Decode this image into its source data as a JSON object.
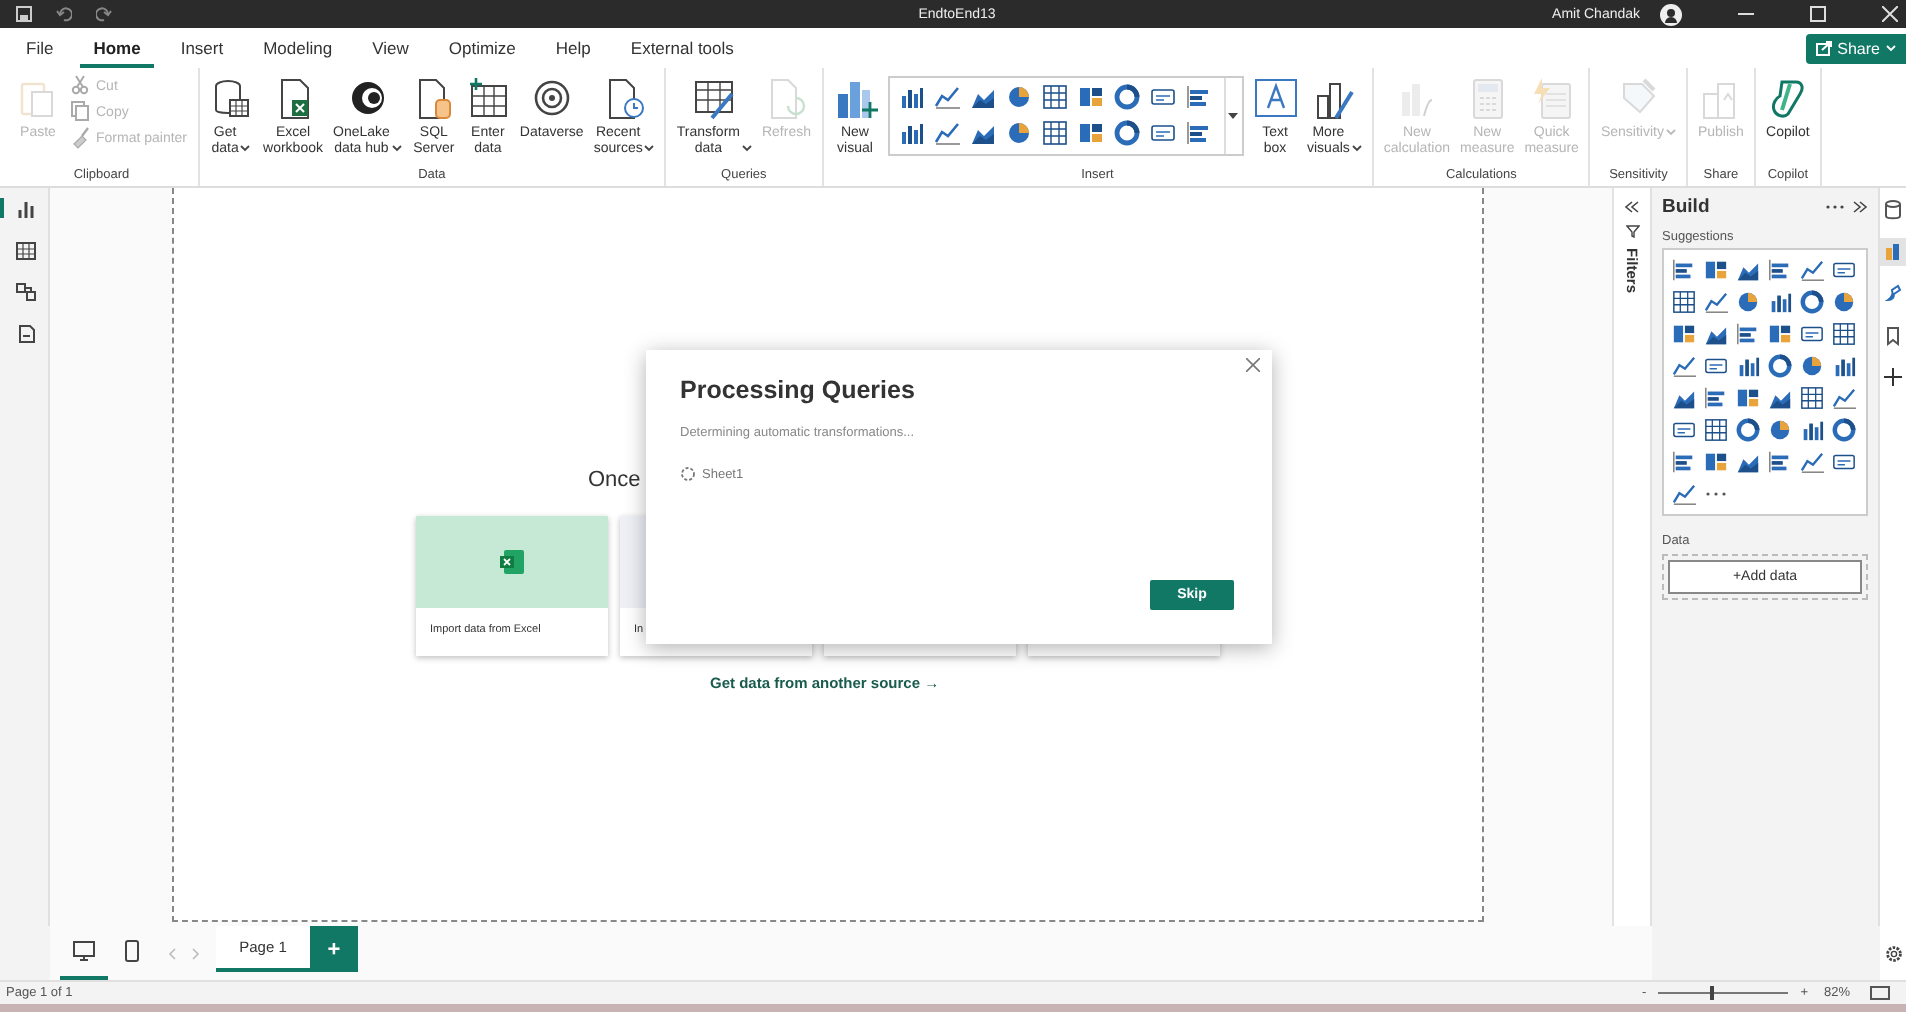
{
  "title_bar": {
    "title": "EndtoEnd13",
    "user": "Amit Chandak"
  },
  "menu_tabs": [
    {
      "label": "File",
      "selected": false
    },
    {
      "label": "Home",
      "selected": true
    },
    {
      "label": "Insert",
      "selected": false
    },
    {
      "label": "Modeling",
      "selected": false
    },
    {
      "label": "View",
      "selected": false
    },
    {
      "label": "Optimize",
      "selected": false
    },
    {
      "label": "Help",
      "selected": false
    },
    {
      "label": "External tools",
      "selected": false
    }
  ],
  "share_button": {
    "label": "Share"
  },
  "ribbon_groups": [
    {
      "label": "Clipboard",
      "buttons": [
        {
          "kind": "large",
          "label": "Paste",
          "disabled": true,
          "dropdown": false
        },
        {
          "kind": "small",
          "label": "Cut",
          "disabled": true,
          "dropdown": false
        },
        {
          "kind": "small",
          "label": "Copy",
          "disabled": true,
          "dropdown": false
        },
        {
          "kind": "small",
          "label": "Format painter",
          "disabled": true,
          "dropdown": false
        }
      ]
    },
    {
      "label": "Data",
      "buttons": [
        {
          "kind": "large",
          "label": "Get\ndata",
          "disabled": false,
          "dropdown": true
        },
        {
          "kind": "large",
          "label": "Excel\nworkbook",
          "disabled": false,
          "dropdown": false
        },
        {
          "kind": "large",
          "label": "OneLake\ndata hub",
          "disabled": false,
          "dropdown": true
        },
        {
          "kind": "large",
          "label": "SQL\nServer",
          "disabled": false,
          "dropdown": false
        },
        {
          "kind": "large",
          "label": "Enter\ndata",
          "disabled": false,
          "dropdown": false
        },
        {
          "kind": "large",
          "label": "Dataverse",
          "disabled": false,
          "dropdown": false
        },
        {
          "kind": "large",
          "label": "Recent\nsources",
          "disabled": false,
          "dropdown": true
        }
      ]
    },
    {
      "label": "Queries",
      "buttons": [
        {
          "kind": "large",
          "label": "Transform\ndata",
          "disabled": false,
          "dropdown": true
        },
        {
          "kind": "large",
          "label": "Refresh",
          "disabled": true,
          "dropdown": false
        }
      ]
    },
    {
      "label": "Insert",
      "buttons": [
        {
          "kind": "large",
          "label": "New\nvisual",
          "disabled": false,
          "dropdown": false
        },
        {
          "kind": "gallery"
        },
        {
          "kind": "large",
          "label": "Text\nbox",
          "disabled": false,
          "dropdown": false
        },
        {
          "kind": "large",
          "label": "More\nvisuals",
          "disabled": false,
          "dropdown": true
        }
      ]
    },
    {
      "label": "Calculations",
      "buttons": [
        {
          "kind": "large",
          "label": "New\ncalculation",
          "disabled": true,
          "dropdown": false
        },
        {
          "kind": "large",
          "label": "New\nmeasure",
          "disabled": true,
          "dropdown": false
        },
        {
          "kind": "large",
          "label": "Quick\nmeasure",
          "disabled": true,
          "dropdown": false
        }
      ]
    },
    {
      "label": "Sensitivity",
      "buttons": [
        {
          "kind": "large",
          "label": "Sensitivity",
          "disabled": true,
          "dropdown": true
        }
      ]
    },
    {
      "label": "Share",
      "buttons": [
        {
          "kind": "large",
          "label": "Publish",
          "disabled": true,
          "dropdown": false
        }
      ]
    },
    {
      "label": "Copilot",
      "buttons": [
        {
          "kind": "large",
          "label": "Copilot",
          "disabled": false,
          "dropdown": false
        }
      ]
    }
  ],
  "left_nav": [
    {
      "selected": true
    },
    {
      "selected": false
    },
    {
      "selected": false
    },
    {
      "selected": false
    }
  ],
  "canvas": {
    "heading": "Once",
    "cards": [
      {
        "label": "Import data from Excel",
        "kind": "excel"
      },
      {
        "label": "In",
        "kind": "plain"
      },
      {
        "kind": "blank"
      },
      {
        "kind": "blank"
      }
    ],
    "link": "Get data from another source →"
  },
  "dialog": {
    "title": "Processing Queries",
    "message": "Determining automatic transformations...",
    "item": "Sheet1",
    "button": "Skip"
  },
  "filters_pane": {
    "label": "Filters"
  },
  "build_pane": {
    "title": "Build",
    "suggestions_label": "Suggestions",
    "data_label": "Data",
    "add_button": "+Add data"
  },
  "right_rail": [
    {
      "selected": false
    },
    {
      "selected": true
    },
    {
      "selected": false
    },
    {
      "selected": false
    },
    {
      "selected": false
    }
  ],
  "view_toggles": [
    {
      "selected": true
    },
    {
      "selected": false
    }
  ],
  "page_tabs": [
    {
      "label": "Page 1",
      "selected": true
    }
  ],
  "add_page_button": "+",
  "status_bar": {
    "page": "Page 1 of 1",
    "zoom_minus": "-",
    "zoom_plus": "+",
    "zoom": {
      "level": 0.42
    },
    "zoom_reading": "82%"
  }
}
